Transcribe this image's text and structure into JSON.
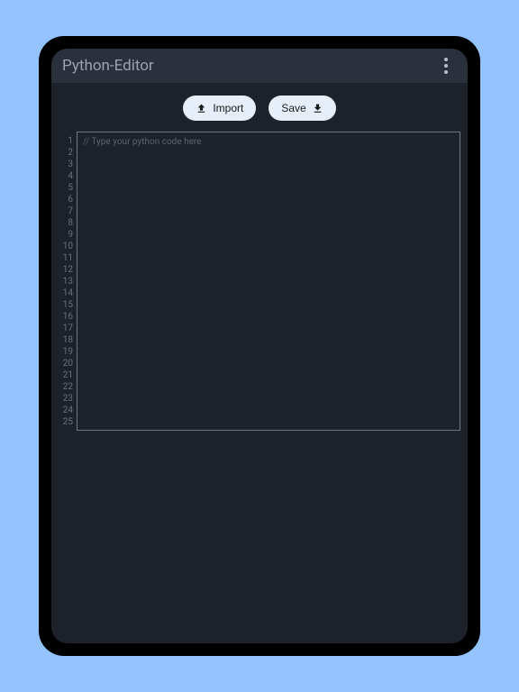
{
  "header": {
    "title": "Python-Editor"
  },
  "toolbar": {
    "import_label": "Import",
    "save_label": "Save"
  },
  "editor": {
    "placeholder": "// Type your python code here",
    "line_count": 25,
    "lines": [
      "1",
      "2",
      "3",
      "4",
      "5",
      "6",
      "7",
      "8",
      "9",
      "10",
      "11",
      "12",
      "13",
      "14",
      "15",
      "16",
      "17",
      "18",
      "19",
      "20",
      "21",
      "22",
      "23",
      "24",
      "25"
    ]
  }
}
